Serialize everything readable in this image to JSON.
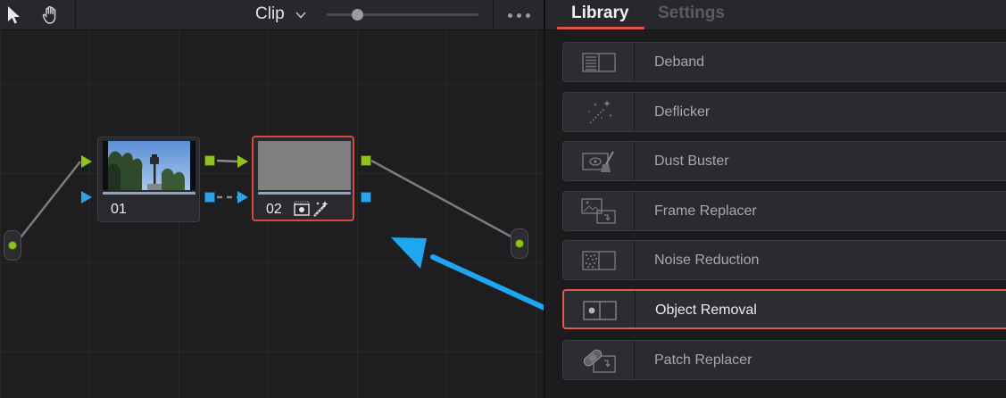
{
  "editor": {
    "toolbar": {
      "pointer_icon": "pointer-arrow-icon",
      "hand_icon": "hand-pan-icon",
      "clip_label": "Clip",
      "chevron_icon": "chevron-down-icon",
      "zoom_level": 0.2,
      "more_icon": "more-dots-icon"
    },
    "nodes": [
      {
        "number": "01",
        "thumbnail": "street-lamp-and-trees-thumbnail",
        "selected": false
      },
      {
        "number": "02",
        "thumbnail": "gray-thumbnail",
        "selected": true,
        "badges": [
          "object-removal-badge-icon",
          "magic-wand-badge-icon"
        ]
      }
    ],
    "colors": {
      "rgb_port": "#8fc31f",
      "alpha_port": "#2fa3e8",
      "selected_node_border": "#d74a3e",
      "annotation_arrow": "#1ea7f0"
    }
  },
  "library": {
    "tabs": [
      {
        "label": "Library",
        "active": true
      },
      {
        "label": "Settings",
        "active": false
      }
    ],
    "items": [
      {
        "label": "Deband",
        "icon": "deband-icon",
        "highlighted": false
      },
      {
        "label": "Deflicker",
        "icon": "deflicker-sparkle-icon",
        "highlighted": false
      },
      {
        "label": "Dust Buster",
        "icon": "dust-buster-broom-icon",
        "highlighted": false
      },
      {
        "label": "Frame Replacer",
        "icon": "frame-replacer-icon",
        "highlighted": false
      },
      {
        "label": "Noise Reduction",
        "icon": "noise-reduction-icon",
        "highlighted": false
      },
      {
        "label": "Object Removal",
        "icon": "object-removal-icon",
        "highlighted": true
      },
      {
        "label": "Patch Replacer",
        "icon": "patch-replacer-bandage-icon",
        "highlighted": false
      }
    ],
    "accent_color": "#e05546"
  }
}
